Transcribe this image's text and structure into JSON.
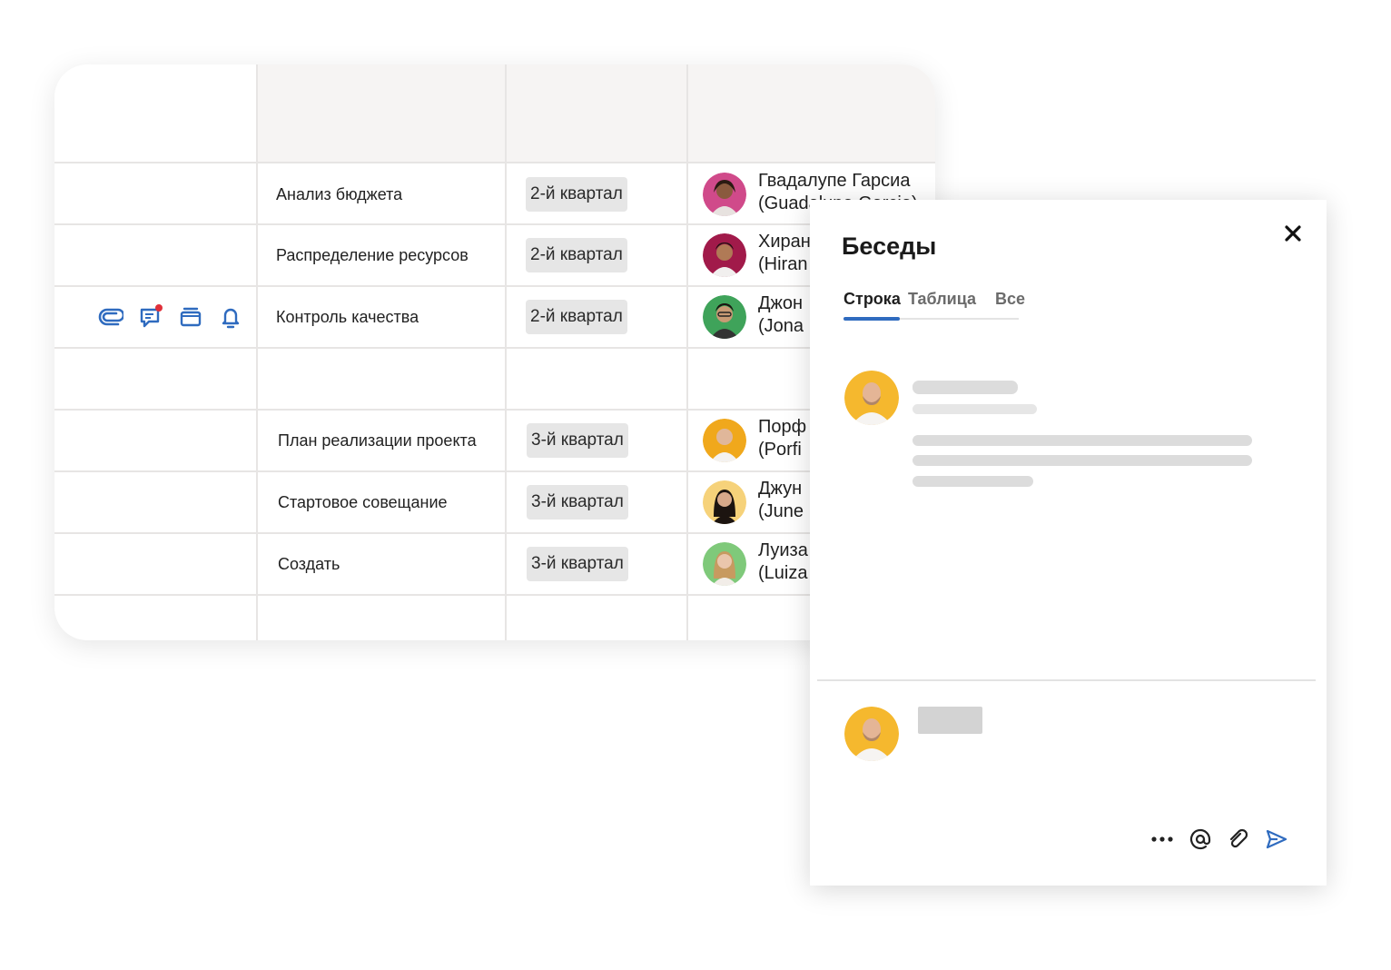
{
  "sheet": {
    "rows": [
      {
        "task": "Анализ бюджета",
        "quarter": "2-й квартал",
        "owner_line1": "Гвадалупе Гарсиа",
        "owner_line2": "(Guadalupe Garcia)",
        "avatar_color": "#d04a8a"
      },
      {
        "task": "Распределение ресурсов",
        "quarter": "2-й квартал",
        "owner_line1": "Хиран",
        "owner_line2": "(Hiran",
        "avatar_color": "#a11a4a"
      },
      {
        "task": "Контроль качества",
        "quarter": "2-й квартал",
        "owner_line1": "Джон",
        "owner_line2": "(Jona",
        "avatar_color": "#3fa35a"
      },
      {
        "task": "",
        "quarter": "",
        "owner_line1": "",
        "owner_line2": ""
      },
      {
        "task": "План реализации проекта",
        "quarter": "3-й квартал",
        "owner_line1": "Порф",
        "owner_line2": "(Porfi",
        "avatar_color": "#f0a81c"
      },
      {
        "task": "Стартовое совещание",
        "quarter": "3-й квартал",
        "owner_line1": "Джун",
        "owner_line2": "(June",
        "avatar_color": "#f6d27a"
      },
      {
        "task": "Создать",
        "quarter": "3-й квартал",
        "owner_line1": "Луиза",
        "owner_line2": "(Luiza",
        "avatar_color": "#7fc97a"
      }
    ],
    "row_icons": [
      "attachment-icon",
      "comment-icon",
      "proof-icon",
      "reminder-icon"
    ],
    "accent": "#2f6bbf",
    "notification_dot": "#e0303a"
  },
  "panel": {
    "title": "Беседы",
    "tabs": [
      {
        "label": "Строка",
        "active": true
      },
      {
        "label": "Таблица",
        "active": false
      },
      {
        "label": "Все",
        "active": false
      }
    ],
    "avatar_color": "#f5b82e",
    "composer_tools": [
      "more-icon",
      "mention-icon",
      "attach-icon",
      "send-icon"
    ]
  }
}
